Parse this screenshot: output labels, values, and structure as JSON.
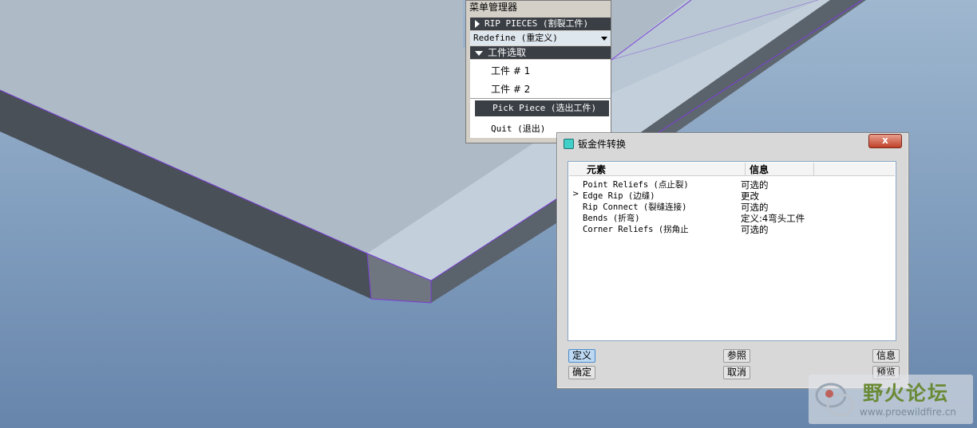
{
  "menu_manager": {
    "title": "菜单管理器",
    "rip_pieces": "RIP PIECES (割裂工件)",
    "redefine": "Redefine (重定义)",
    "piece_select": "工件选取",
    "piece1": "工件 # 1",
    "piece2": "工件 # 2",
    "pick_piece": "Pick Piece (选出工件)",
    "quit": "Quit (退出)"
  },
  "dialog": {
    "title": "钣金件转换",
    "close_label": "x",
    "columns": [
      "元素",
      "信息"
    ],
    "rows": [
      {
        "marker": "",
        "element": "Point Reliefs (点止裂)",
        "info": "可选的"
      },
      {
        "marker": ">",
        "element": "Edge Rip (边缝)",
        "info": "更改"
      },
      {
        "marker": "",
        "element": "Rip Connect (裂缝连接)",
        "info": "可选的"
      },
      {
        "marker": "",
        "element": "Bends (折弯)",
        "info": "定义:4弯头工件"
      },
      {
        "marker": "",
        "element": "Corner Reliefs (拐角止",
        "info": "可选的"
      }
    ],
    "buttons": {
      "define": "定义",
      "reference": "参照",
      "info": "信息",
      "ok": "确定",
      "cancel": "取消",
      "preview": "预览"
    }
  },
  "watermark": {
    "name": "野火论坛",
    "url": "www.proewildfire.cn"
  },
  "colors": {
    "part_top": "#aebbc6",
    "part_side": "#4a5058",
    "edge_line": "#7b3fd6",
    "selection": "#3a3f45"
  }
}
